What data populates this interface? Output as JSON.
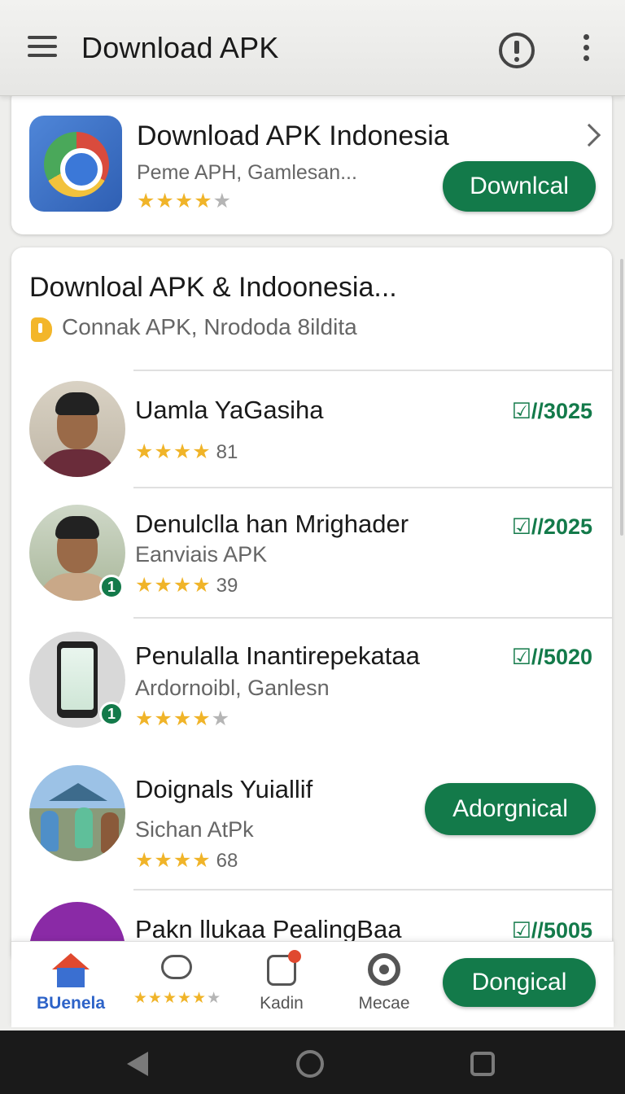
{
  "appbar": {
    "title": "Download APK"
  },
  "featured": {
    "title": "Download APK Indonesia",
    "subtitle": "Peme APH, Gamlesan...",
    "stars": "★★★★",
    "stars_off": "★",
    "button": "Downlcal"
  },
  "list": {
    "title": "Downloal APK & Indoonesia...",
    "subtitle": "Connak APK, Nrododa 8ildita",
    "items": [
      {
        "title": "Uamla YaGasiha",
        "subtitle": "",
        "stars": "★★★★",
        "stars_off": "",
        "count": "81",
        "date": "☑//3025",
        "badge": ""
      },
      {
        "title": "Denulclla han Mrighader",
        "subtitle": "Eanviais APK",
        "stars": "★★★★",
        "stars_off": "",
        "count": "39",
        "date": "☑//2025",
        "badge": "1"
      },
      {
        "title": "Penulalla Inantirepekataa",
        "subtitle": "Ardornoibl, Ganlesn",
        "stars": "★★★★",
        "stars_off": "★",
        "count": "",
        "date": "☑//5020",
        "badge": "1"
      },
      {
        "title": "Doignals Yuiallif",
        "subtitle": "Sichan AtPk",
        "stars": "★★★★",
        "stars_off": "",
        "count": "68",
        "button": "Adorgnical"
      },
      {
        "title": "Pakn llukaa PealingBaa",
        "date": "☑//5005"
      }
    ]
  },
  "bottom_nav": {
    "items": [
      {
        "label": "BUenela",
        "icon": "home-icon"
      },
      {
        "label": "",
        "icon": "chat-icon",
        "stars": "★★★★★",
        "stars_off": "★"
      },
      {
        "label": "Kadin",
        "icon": "tag-icon"
      },
      {
        "label": "Mecae",
        "icon": "media-icon"
      }
    ],
    "button": "Dongical"
  },
  "colors": {
    "accent": "#137a4a",
    "star": "#f0b429",
    "home_active": "#2d63c8"
  }
}
